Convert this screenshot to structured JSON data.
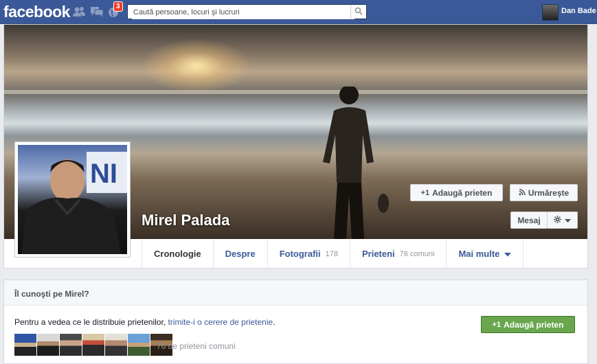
{
  "topbar": {
    "logo": "facebook",
    "notifications_badge": "3",
    "search_placeholder": "Caută persoane, locuri şi lucruri",
    "user_name": "Dan Bade"
  },
  "profile": {
    "name": "Mirel Palada",
    "add_friend": "Adaugă prieten",
    "follow": "Urmărește",
    "message": "Mesaj"
  },
  "tabs": [
    {
      "label": "Cronologie",
      "count": ""
    },
    {
      "label": "Despre",
      "count": ""
    },
    {
      "label": "Fotografii",
      "count": "178"
    },
    {
      "label": "Prieteni",
      "count": "76 comuni"
    },
    {
      "label": "Mai multe",
      "count": ""
    }
  ],
  "know": {
    "title": "Îl cunoşti pe Mirel?",
    "text": "Pentru a vedea ce le distribuie prietenilor, ",
    "link": "trimite-i o cerere de prietenie",
    "text_end": ".",
    "add_button": "Adaugă prieten",
    "mutual": "76 de prieteni comuni"
  },
  "colors": {
    "brand": "#3b5998",
    "badge": "#f03d25",
    "green": "#69a74e"
  }
}
